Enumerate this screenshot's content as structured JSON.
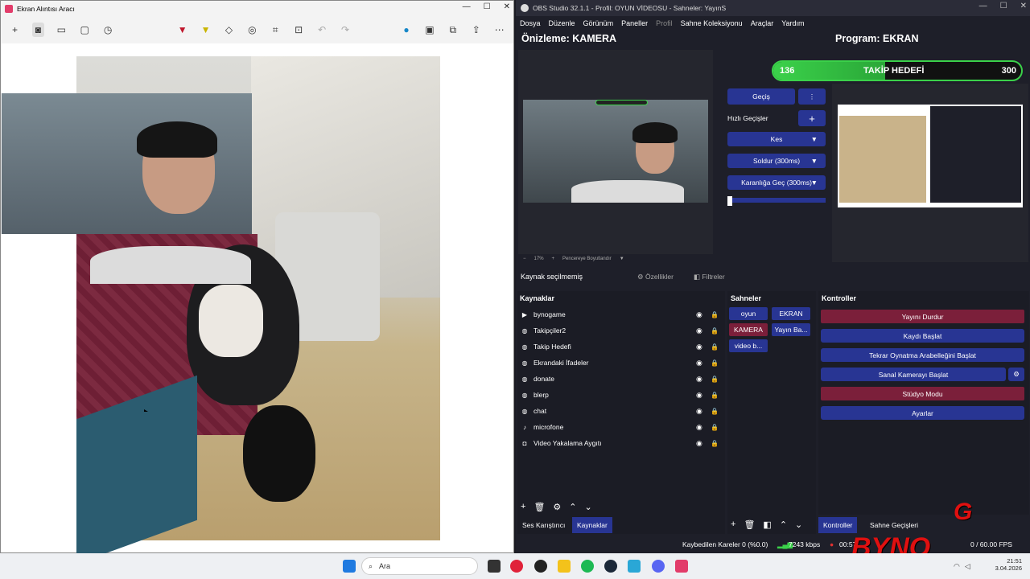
{
  "snip": {
    "title": "Ekran Alıntısı Aracı",
    "win_min": "—",
    "win_max": "☐",
    "win_close": "✕"
  },
  "obs": {
    "title": "OBS Studio 32.1.1 - Profil: OYUN VİDEOSU - Sahneler: YayınS",
    "menu": [
      "Dosya",
      "Düzenle",
      "Görünüm",
      "Paneller",
      "Profil",
      "Sahne Koleksiyonu",
      "Araçlar",
      "Yardım"
    ],
    "preview_label": "Önizleme: KAMERA",
    "program_label": "Program: EKRAN",
    "goal": {
      "current": "136",
      "label": "TAKİP HEDEFİ",
      "target": "300",
      "progress": 0.45
    },
    "transition": {
      "button": "Geçiş",
      "quick_label": "Hızlı Geçişler",
      "options": [
        "Kes",
        "Soldur (300ms)",
        "Karanlığa Geç (300ms)"
      ]
    },
    "zoom": {
      "value": "17%",
      "fit": "Pencereye Boyutlandır"
    },
    "no_source": "Kaynak seçilmemiş",
    "properties": "Özellikler",
    "filters": "Filtreler",
    "sources_title": "Kaynaklar",
    "sources": [
      {
        "icon": "play-icon",
        "name": "bynogame"
      },
      {
        "icon": "browser-icon",
        "name": "Takipçiler2"
      },
      {
        "icon": "browser-icon",
        "name": "Takip Hedefi"
      },
      {
        "icon": "browser-icon",
        "name": "Ekrandaki İfadeler"
      },
      {
        "icon": "browser-icon",
        "name": "donate"
      },
      {
        "icon": "browser-icon",
        "name": "blerp"
      },
      {
        "icon": "browser-icon",
        "name": "chat"
      },
      {
        "icon": "mic-icon",
        "name": "microfone"
      },
      {
        "icon": "camera-icon",
        "name": "Video Yakalama Aygıtı"
      }
    ],
    "scenes_title": "Sahneler",
    "scenes": [
      "oyun",
      "EKRAN",
      "KAMERA",
      "Yayın Ba...",
      "video b..."
    ],
    "controls_title": "Kontroller",
    "controls": [
      "Yayını Durdur",
      "Kaydı Başlat",
      "Tekrar Oynatma Arabelleğini Başlat",
      "Sanal Kamerayı Başlat",
      "Stüdyo Modu",
      "Ayarlar"
    ],
    "bottom_tabs": [
      "Ses Karıştırıcı",
      "Kaynaklar",
      "Kontroller",
      "Sahne Geçişleri"
    ],
    "status": {
      "dropped": "Kaybedilen Kareler 0 (%0.0)",
      "bitrate": "7243 kbps",
      "time": "00:57:",
      "fps": "0 / 60.00 FPS"
    }
  },
  "taskbar": {
    "search": "Ara",
    "time": "21:51",
    "date": "3.04.2026"
  },
  "watermark": "BYNO"
}
